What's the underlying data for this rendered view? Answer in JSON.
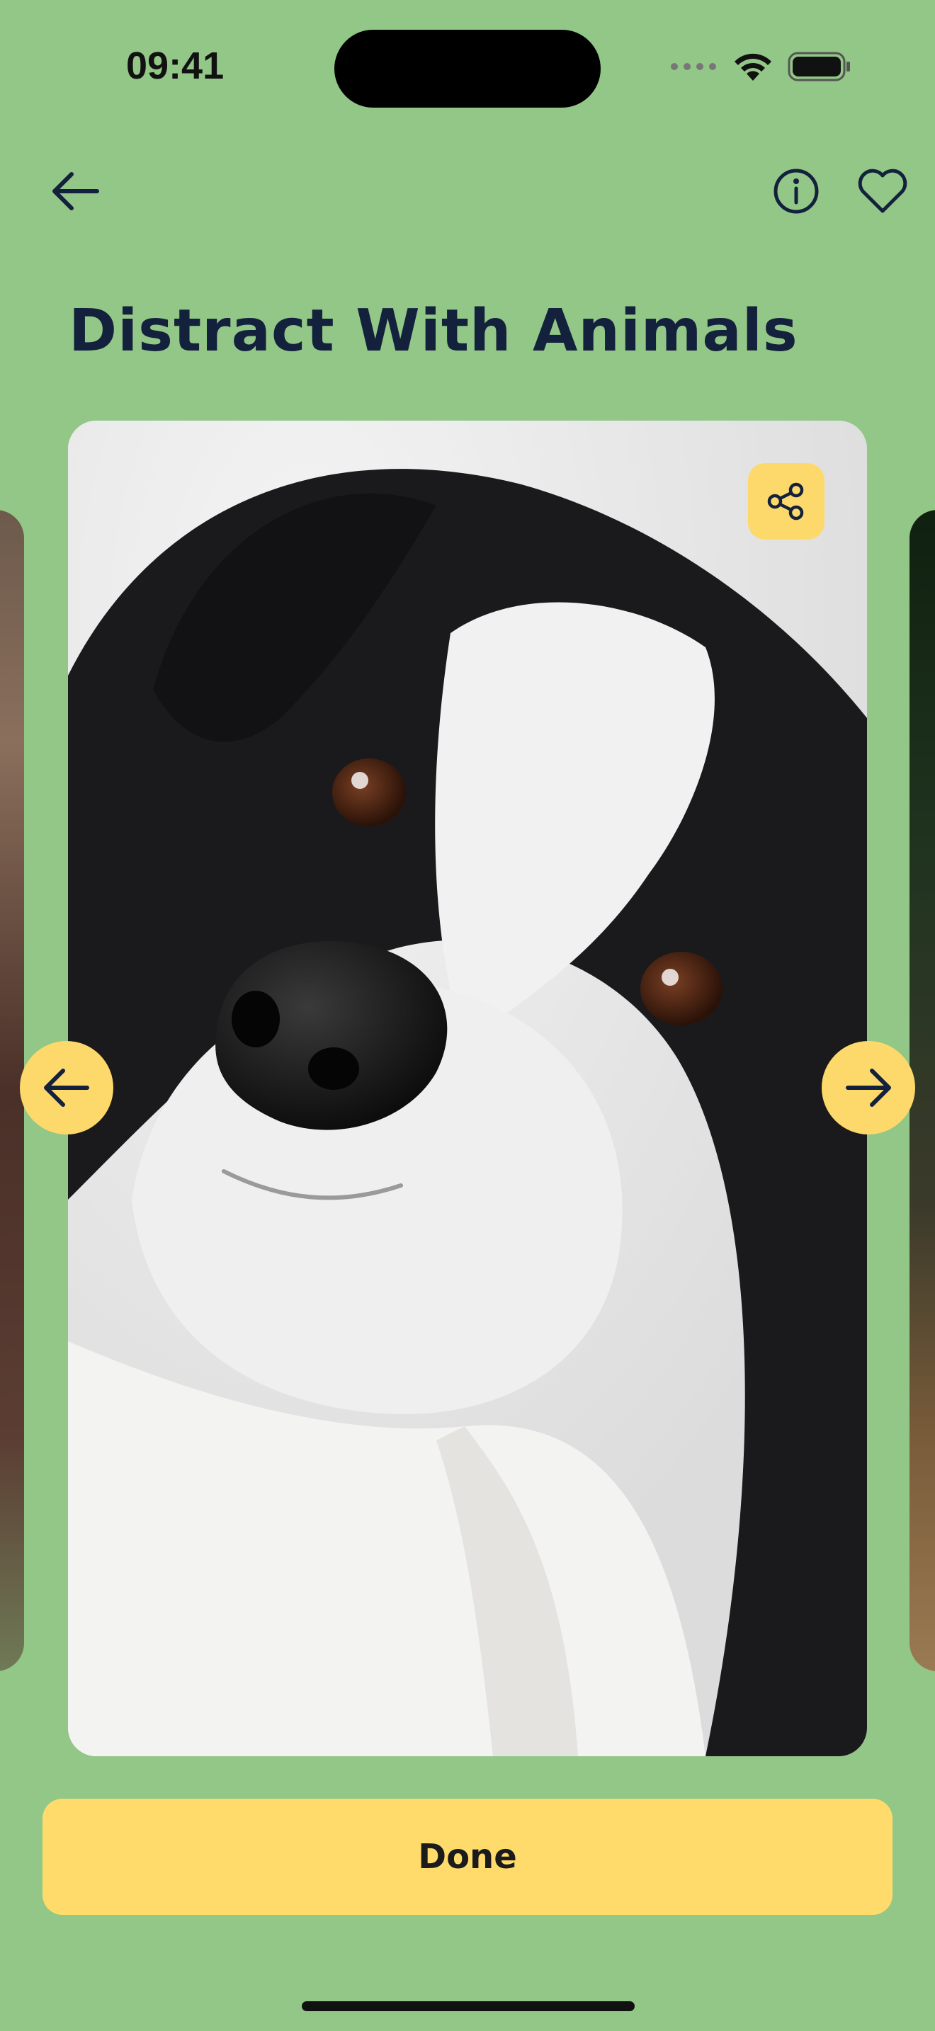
{
  "status_bar": {
    "time": "09:41",
    "icons": [
      "signal-dots-icon",
      "wifi-icon",
      "battery-icon"
    ]
  },
  "header": {
    "back_icon": "arrow-left-icon",
    "info_icon": "info-circle-icon",
    "favorite_icon": "heart-icon"
  },
  "page": {
    "title": "Distract With Animals"
  },
  "carousel": {
    "share_icon": "share-icon",
    "prev_icon": "arrow-left-icon",
    "next_icon": "arrow-right-icon",
    "current_image": "border-collie-photo"
  },
  "actions": {
    "done_label": "Done"
  },
  "colors": {
    "background": "#93c787",
    "accent": "#fedb6a",
    "title": "#14213d"
  }
}
